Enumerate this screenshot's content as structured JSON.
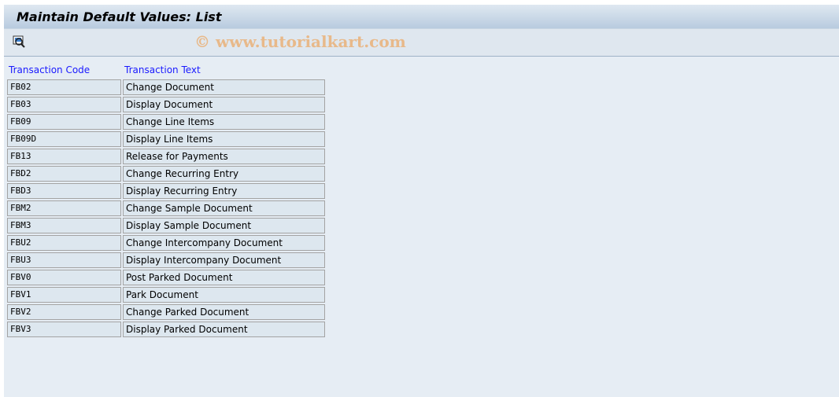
{
  "title": "Maintain Default Values: List",
  "toolbar": {
    "watermark": "© www.tutorialkart.com",
    "icon": "details-magnifier-icon"
  },
  "columns": {
    "code": "Transaction Code",
    "text": "Transaction Text"
  },
  "rows": [
    {
      "code": "FB02",
      "text": "Change Document"
    },
    {
      "code": "FB03",
      "text": "Display Document"
    },
    {
      "code": "FB09",
      "text": "Change Line Items"
    },
    {
      "code": "FB09D",
      "text": "Display Line Items"
    },
    {
      "code": "FB13",
      "text": "Release for Payments"
    },
    {
      "code": "FBD2",
      "text": "Change Recurring Entry"
    },
    {
      "code": "FBD3",
      "text": "Display Recurring Entry"
    },
    {
      "code": "FBM2",
      "text": "Change Sample Document"
    },
    {
      "code": "FBM3",
      "text": "Display Sample Document"
    },
    {
      "code": "FBU2",
      "text": "Change Intercompany Document"
    },
    {
      "code": "FBU3",
      "text": "Display Intercompany Document"
    },
    {
      "code": "FBV0",
      "text": "Post Parked Document"
    },
    {
      "code": "FBV1",
      "text": "Park Document"
    },
    {
      "code": "FBV2",
      "text": "Change Parked Document"
    },
    {
      "code": "FBV3",
      "text": "Display Parked Document"
    }
  ]
}
